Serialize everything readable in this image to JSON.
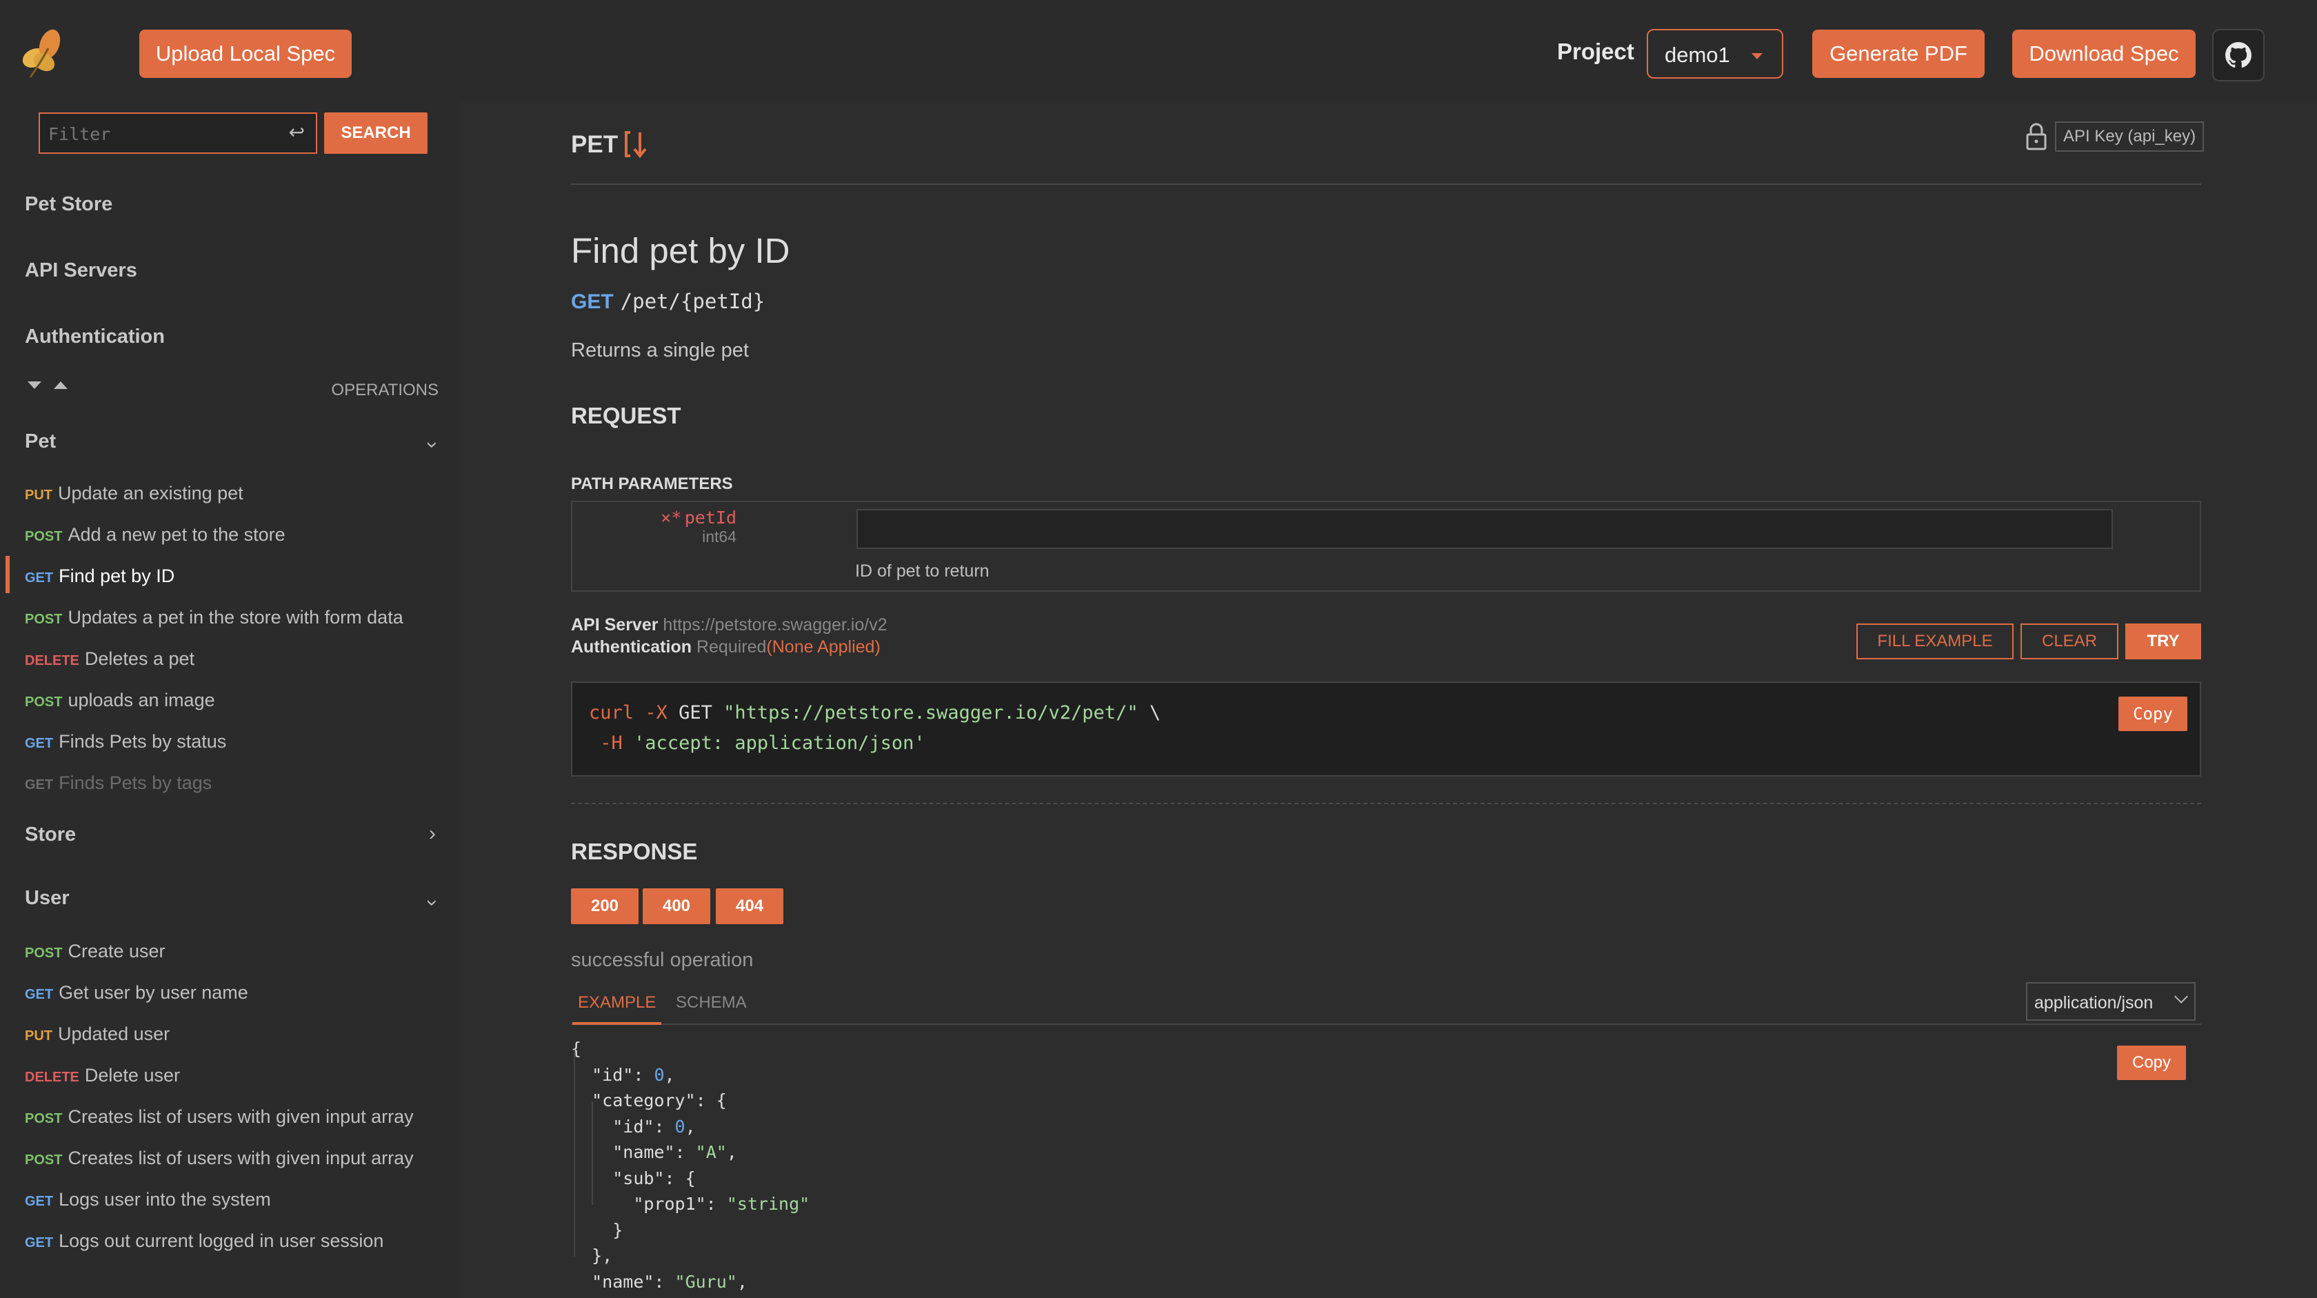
{
  "header": {
    "upload_label": "Upload Local Spec",
    "project_label": "Project",
    "project_value": "demo1",
    "pdf_label": "Generate PDF",
    "download_label": "Download Spec",
    "accent": "#e06c43"
  },
  "sidebar": {
    "filter_placeholder": "Filter",
    "search_label": "SEARCH",
    "links": [
      "Pet Store",
      "API Servers",
      "Authentication"
    ],
    "operations_label": "OPERATIONS",
    "groups": [
      {
        "name": "Pet",
        "expanded": true,
        "ops": [
          {
            "method": "PUT",
            "label": "Update an existing pet"
          },
          {
            "method": "POST",
            "label": "Add a new pet to the store"
          },
          {
            "method": "GET",
            "label": "Find pet by ID"
          },
          {
            "method": "POST",
            "label": "Updates a pet in the store with form data"
          },
          {
            "method": "DELETE",
            "label": "Deletes a pet"
          },
          {
            "method": "POST",
            "label": "uploads an image"
          },
          {
            "method": "GET",
            "label": "Finds Pets by status"
          },
          {
            "method": "GET",
            "label": "Finds Pets by tags"
          }
        ]
      },
      {
        "name": "Store",
        "expanded": false,
        "ops": []
      },
      {
        "name": "User",
        "expanded": true,
        "ops": [
          {
            "method": "POST",
            "label": "Create user"
          },
          {
            "method": "GET",
            "label": "Get user by user name"
          },
          {
            "method": "PUT",
            "label": "Updated user"
          },
          {
            "method": "DELETE",
            "label": "Delete user"
          },
          {
            "method": "POST",
            "label": "Creates list of users with given input array"
          },
          {
            "method": "POST",
            "label": "Creates list of users with given input array"
          },
          {
            "method": "GET",
            "label": "Logs user into the system"
          },
          {
            "method": "GET",
            "label": "Logs out current logged in user session"
          }
        ]
      }
    ]
  },
  "main": {
    "tag": "PET",
    "api_key_label": "API Key (api_key)",
    "title": "Find pet by ID",
    "method": "GET",
    "path": "/pet/{petId}",
    "description": "Returns a single pet",
    "request_heading": "REQUEST",
    "path_params_heading": "PATH PARAMETERS",
    "param": {
      "name": "petId",
      "required_mark": "×*",
      "type": "int64",
      "hint": "ID of pet to return",
      "value": ""
    },
    "server_label": "API Server",
    "server_url": "https://petstore.swagger.io/v2",
    "auth_label": "Authentication",
    "auth_required": "Required",
    "auth_status": "(None Applied)",
    "fill_example": "FILL EXAMPLE",
    "clear": "CLEAR",
    "try": "TRY",
    "curl": {
      "cmd": "curl",
      "flag": "-X",
      "verb": "GET",
      "url": "\"https://petstore.swagger.io/v2/pet/\"",
      "cont": "\\",
      "h_flag": "-H",
      "header": "'accept: application/json'"
    },
    "copy": "Copy",
    "response_heading": "RESPONSE",
    "codes": [
      "200",
      "400",
      "404"
    ],
    "response_desc": "successful operation",
    "tab_example": "EXAMPLE",
    "tab_schema": "SCHEMA",
    "mime": "application/json",
    "example_json": {
      "id_key": "\"id\"",
      "id_val": "0",
      "category_key": "\"category\"",
      "cat_id_key": "\"id\"",
      "cat_id_val": "0",
      "cat_name_key": "\"name\"",
      "cat_name_val": "\"A\"",
      "sub_key": "\"sub\"",
      "prop1_key": "\"prop1\"",
      "prop1_val": "\"string\"",
      "name_key": "\"name\"",
      "name_val": "\"Guru\""
    }
  }
}
